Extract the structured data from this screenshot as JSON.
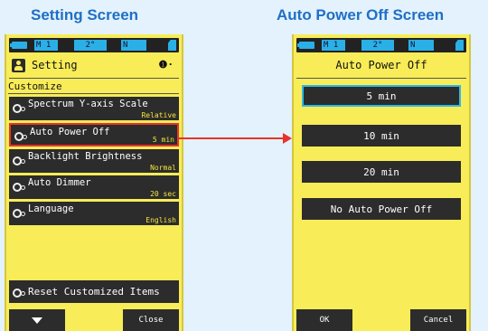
{
  "captions": {
    "left": "Setting Screen",
    "right": "Auto Power Off Screen"
  },
  "statusbar": {
    "mode": "M 1",
    "angle": "2°",
    "icon": "N"
  },
  "setting_screen": {
    "title": "Setting",
    "info_icon": "❶·",
    "section": "Customize",
    "items": [
      {
        "label": "Spectrum Y-axis Scale",
        "value": "Relative"
      },
      {
        "label": "Auto Power Off",
        "value": "5 min"
      },
      {
        "label": "Backlight Brightness",
        "value": "Normal"
      },
      {
        "label": "Auto Dimmer",
        "value": "20 sec"
      },
      {
        "label": "Language",
        "value": "English"
      }
    ],
    "reset_label": "Reset Customized Items",
    "close_label": "Close"
  },
  "apo_screen": {
    "title": "Auto Power Off",
    "options": [
      "5 min",
      "10 min",
      "20 min",
      "No Auto Power Off"
    ],
    "selected_option": "5 min",
    "ok_label": "OK",
    "cancel_label": "Cancel"
  },
  "colors": {
    "device_yellow": "#f8ec58",
    "selection_red": "#e8332a",
    "selection_blue": "#31b7e6",
    "caption_blue": "#1f6fc6"
  },
  "icons": [
    "battery-icon",
    "user-icon",
    "gear-icon",
    "down-arrow-icon",
    "sd-card-icon",
    "info-icon"
  ]
}
